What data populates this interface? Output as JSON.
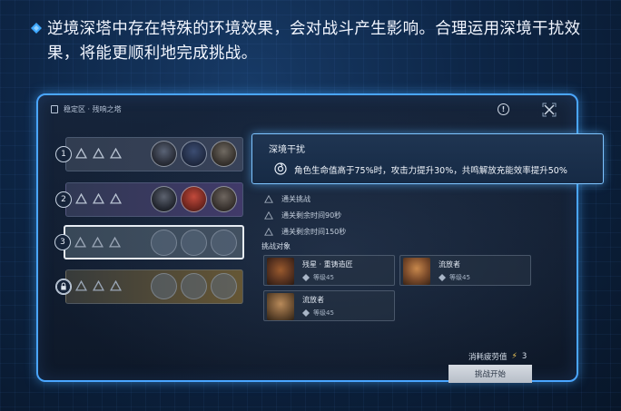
{
  "headline": {
    "text": "逆境深塔中存在特殊的环境效果，会对战斗产生影响。合理运用深境干扰效果，将能更顺利地完成挑战。",
    "accent_color": "#3ea8ff"
  },
  "panel": {
    "breadcrumb": "稳定区 · 残响之塔",
    "icons": [
      "bookmark-icon",
      "info-icon",
      "close-icon"
    ]
  },
  "floors": [
    {
      "number": "1",
      "state": "cleared"
    },
    {
      "number": "2",
      "state": "cleared"
    },
    {
      "number": "3",
      "state": "selected"
    },
    {
      "number": "",
      "state": "locked"
    }
  ],
  "tooltip": {
    "title": "深境干扰",
    "effect": "角色生命值高于75%时，攻击力提升30%，共鸣解放充能效率提升50%"
  },
  "goals": [
    "通关挑战",
    "通关剩余时间90秒",
    "通关剩余时间150秒"
  ],
  "enemies": {
    "title": "挑战对象",
    "list": [
      {
        "name": "残星 · 重铸造匠",
        "level": "等级45"
      },
      {
        "name": "流放者",
        "level": "等级45"
      },
      {
        "name": "流放者",
        "level": "等级45"
      }
    ]
  },
  "cost": {
    "label": "消耗疲劳值",
    "value": "3"
  },
  "start_button": "挑战开始"
}
